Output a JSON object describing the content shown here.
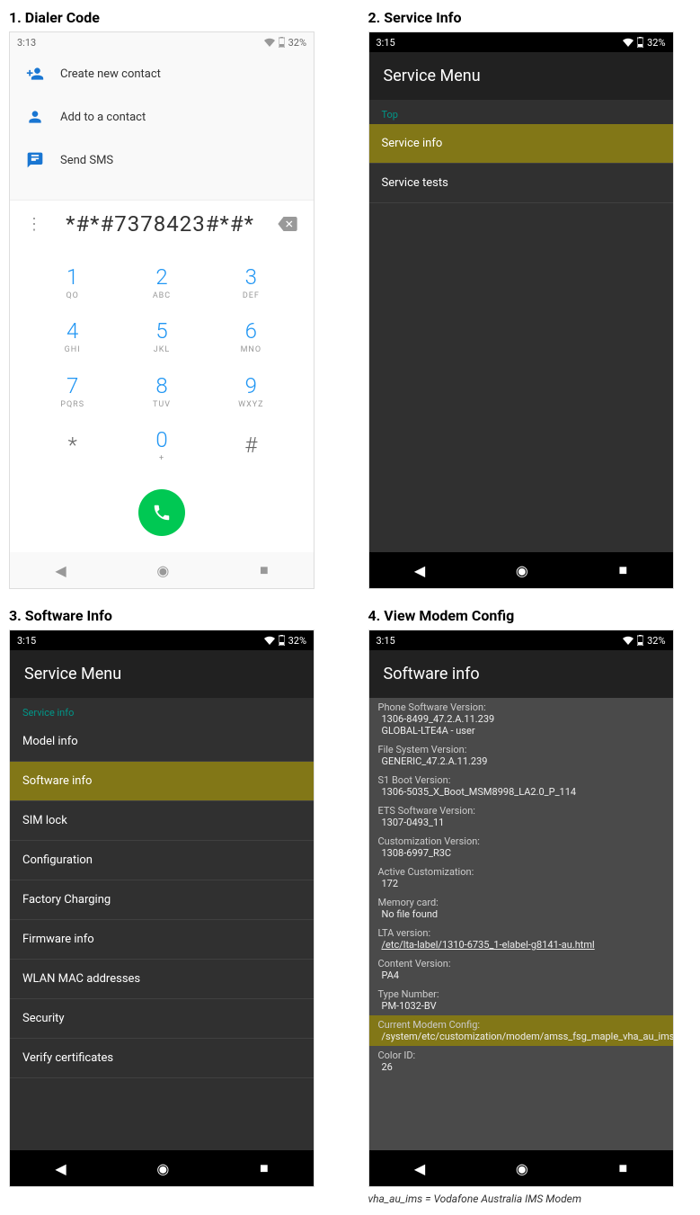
{
  "steps": {
    "s1": "1. Dialer Code",
    "s2": "2. Service Info",
    "s3": "3. Software Info",
    "s4": "4. View Modem Config"
  },
  "status": {
    "time1": "3:13",
    "time2": "3:15",
    "battery": "32%"
  },
  "dialer": {
    "actions": {
      "create": "Create new contact",
      "add": "Add to a contact",
      "sms": "Send SMS"
    },
    "number": "*#*#7378423#*#*",
    "keys": [
      {
        "d": "1",
        "l": "QO"
      },
      {
        "d": "2",
        "l": "ABC"
      },
      {
        "d": "3",
        "l": "DEF"
      },
      {
        "d": "4",
        "l": "GHI"
      },
      {
        "d": "5",
        "l": "JKL"
      },
      {
        "d": "6",
        "l": "MNO"
      },
      {
        "d": "7",
        "l": "PQRS"
      },
      {
        "d": "8",
        "l": "TUV"
      },
      {
        "d": "9",
        "l": "WXYZ"
      },
      {
        "d": "*",
        "l": ""
      },
      {
        "d": "0",
        "l": "+"
      },
      {
        "d": "#",
        "l": ""
      }
    ]
  },
  "serviceMenu": {
    "title": "Service Menu",
    "breadcrumb_top": "Top",
    "breadcrumb_si": "Service info",
    "items_top": [
      "Service info",
      "Service tests"
    ],
    "items_si": [
      "Model info",
      "Software info",
      "SIM lock",
      "Configuration",
      "Factory Charging",
      "Firmware info",
      "WLAN MAC addresses",
      "Security",
      "Verify certificates"
    ]
  },
  "softwareInfo": {
    "title": "Software info",
    "rows": [
      {
        "label": "Phone Software Version:",
        "value": "1306-8499_47.2.A.11.239",
        "value2": "GLOBAL-LTE4A - user"
      },
      {
        "label": "File System Version:",
        "value": "GENERIC_47.2.A.11.239"
      },
      {
        "label": "S1 Boot Version:",
        "value": "1306-5035_X_Boot_MSM8998_LA2.0_P_114"
      },
      {
        "label": "ETS Software Version:",
        "value": "1307-0493_11"
      },
      {
        "label": "Customization Version:",
        "value": "1308-6997_R3C"
      },
      {
        "label": "Active Customization:",
        "value": "172"
      },
      {
        "label": "Memory card:",
        "value": "No file found"
      },
      {
        "label": "LTA version:",
        "value": "/etc/lta-label/1310-6735_1-elabel-g8141-au.html",
        "underline": true
      },
      {
        "label": "Content Version:",
        "value": "PA4"
      },
      {
        "label": "Type Number:",
        "value": "PM-1032-BV"
      },
      {
        "label": "Current Modem Config:",
        "value": "/system/etc/customization/modem/amss_fsg_maple_vha_au_ims_tar.mbn",
        "highlight": true
      },
      {
        "label": "Color ID:",
        "value": "26"
      }
    ]
  },
  "caption": "vha_au_ims = Vodafone Australia IMS Modem"
}
